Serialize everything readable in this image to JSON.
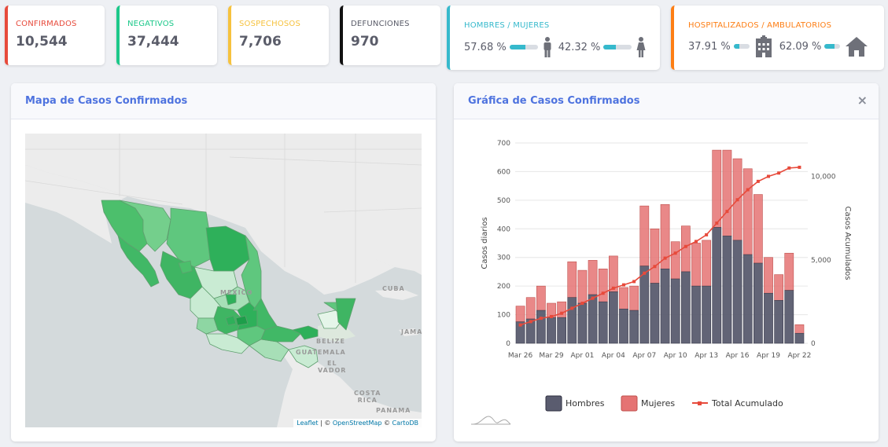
{
  "stats": {
    "confirmados": {
      "label": "CONFIRMADOS",
      "value": "10,544",
      "color": "#e74a3b"
    },
    "negativos": {
      "label": "NEGATIVOS",
      "value": "37,444",
      "color": "#1cc88a"
    },
    "sospechosos": {
      "label": "SOSPECHOSOS",
      "value": "7,706",
      "color": "#f6c23e"
    },
    "defunciones": {
      "label": "DEFUNCIONES",
      "value": "970",
      "color": "#111111"
    }
  },
  "gender": {
    "label": "HOMBRES / MUJERES",
    "color": "#36b9cc",
    "men_pct": "57.68 %",
    "men_fraction": 0.5768,
    "women_pct": "42.32 %",
    "women_fraction": 0.4232,
    "men_icon": "male-icon",
    "women_icon": "female-icon"
  },
  "hospital": {
    "label": "HOSPITALIZADOS / AMBULATORIOS",
    "color": "#fd7e14",
    "hosp_pct": "37.91 %",
    "hosp_fraction": 0.3791,
    "amb_pct": "62.09 %",
    "amb_fraction": 0.6209,
    "hosp_icon": "hospital-icon",
    "amb_icon": "house-icon"
  },
  "map_panel": {
    "title": "Mapa de Casos Confirmados",
    "labels": {
      "mexico": "MEXICO",
      "cuba": "CUBA",
      "jamaica": "JAMAI",
      "belize": "BELIZE",
      "guatemala": "GUATEMALA",
      "salvador": "EL\nVADOR",
      "costa_rica": "COSTA\nRICA",
      "panama": "PANAMA"
    },
    "attribution": {
      "leaflet": "Leaflet",
      "sep1": " | © ",
      "osm": "OpenStreetMap",
      "sep2": " © ",
      "carto": "CartoDB"
    }
  },
  "chart_panel": {
    "title": "Gráfica de Casos Confirmados",
    "close": "×"
  },
  "chart_data": {
    "type": "bar",
    "ylabel": "Casos diarios",
    "y2label": "Casos Acumulados",
    "ylim": [
      0,
      700
    ],
    "y2lim": [
      0,
      12000
    ],
    "yticks": [
      0,
      100,
      200,
      300,
      400,
      500,
      600,
      700
    ],
    "y2ticks": [
      "0",
      "5,000",
      "10,000"
    ],
    "x_ticks": [
      "Mar 26",
      "Mar 29",
      "Apr 01",
      "Apr 04",
      "Apr 07",
      "Apr 10",
      "Apr 13",
      "Apr 16",
      "Apr 19",
      "Apr 22"
    ],
    "categories": [
      "Mar 26",
      "Mar 27",
      "Mar 28",
      "Mar 29",
      "Mar 30",
      "Mar 31",
      "Apr 01",
      "Apr 02",
      "Apr 03",
      "Apr 04",
      "Apr 05",
      "Apr 06",
      "Apr 07",
      "Apr 08",
      "Apr 09",
      "Apr 10",
      "Apr 11",
      "Apr 12",
      "Apr 13",
      "Apr 14",
      "Apr 15",
      "Apr 16",
      "Apr 17",
      "Apr 18",
      "Apr 19",
      "Apr 20",
      "Apr 21",
      "Apr 22"
    ],
    "series": [
      {
        "name": "Hombres",
        "type": "bar",
        "color": "#5a5c6f",
        "values": [
          75,
          85,
          115,
          90,
          90,
          160,
          140,
          170,
          145,
          180,
          120,
          115,
          270,
          210,
          260,
          225,
          250,
          200,
          200,
          405,
          375,
          360,
          310,
          280,
          175,
          150,
          185,
          35
        ]
      },
      {
        "name": "Mujeres",
        "type": "bar",
        "color": "#e57373",
        "values": [
          55,
          75,
          85,
          50,
          55,
          125,
          115,
          120,
          115,
          125,
          75,
          85,
          210,
          190,
          225,
          130,
          160,
          150,
          160,
          270,
          300,
          285,
          300,
          240,
          125,
          90,
          130,
          30
        ]
      },
      {
        "name": "Total Acumulado",
        "type": "line",
        "color": "#e74a3b",
        "values": [
          1100,
          1300,
          1500,
          1600,
          1800,
          2100,
          2400,
          2700,
          3000,
          3300,
          3500,
          3700,
          4200,
          4600,
          5100,
          5400,
          5800,
          6100,
          6500,
          7200,
          7900,
          8600,
          9200,
          9700,
          10000,
          10200,
          10500,
          10544
        ]
      }
    ],
    "legend": [
      "Hombres",
      "Mujeres",
      "Total Acumulado"
    ],
    "legend_position": "bottom",
    "grid": true
  }
}
